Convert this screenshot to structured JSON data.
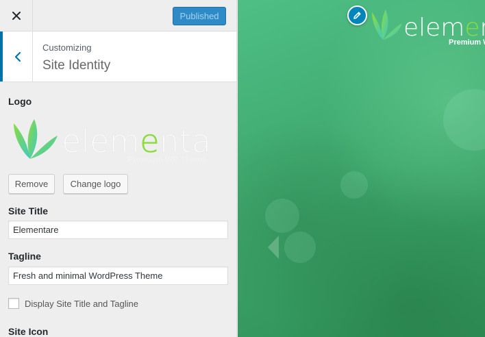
{
  "header": {
    "close_icon": "close-icon",
    "publish_label": "Published"
  },
  "section": {
    "back_icon": "chevron-left-icon",
    "customizing_label": "Customizing",
    "title": "Site Identity"
  },
  "logo": {
    "label": "Logo",
    "brand_text": "elementare",
    "brand_highlight_letter": "e",
    "brand_tagline": "Premium WP Theme",
    "remove_label": "Remove",
    "change_label": "Change logo"
  },
  "site_title": {
    "label": "Site Title",
    "value": "Elementare"
  },
  "tagline": {
    "label": "Tagline",
    "value": "Fresh and minimal WordPress Theme"
  },
  "display_title": {
    "checked": false,
    "label": "Display Site Title and Tagline"
  },
  "site_icon": {
    "label": "Site Icon"
  },
  "preview": {
    "edit_icon": "pencil-icon",
    "brand_text": "elementare",
    "brand_tagline": "Premium WP Theme",
    "nav_icon": "chevron-left-icon"
  },
  "colors": {
    "accent": "#0073aa",
    "publish_bg": "#2e8bc8",
    "logo_green": "#8bdc3b",
    "logo_teal": "#3fc8c8",
    "preview_green": "#3fa96e"
  }
}
